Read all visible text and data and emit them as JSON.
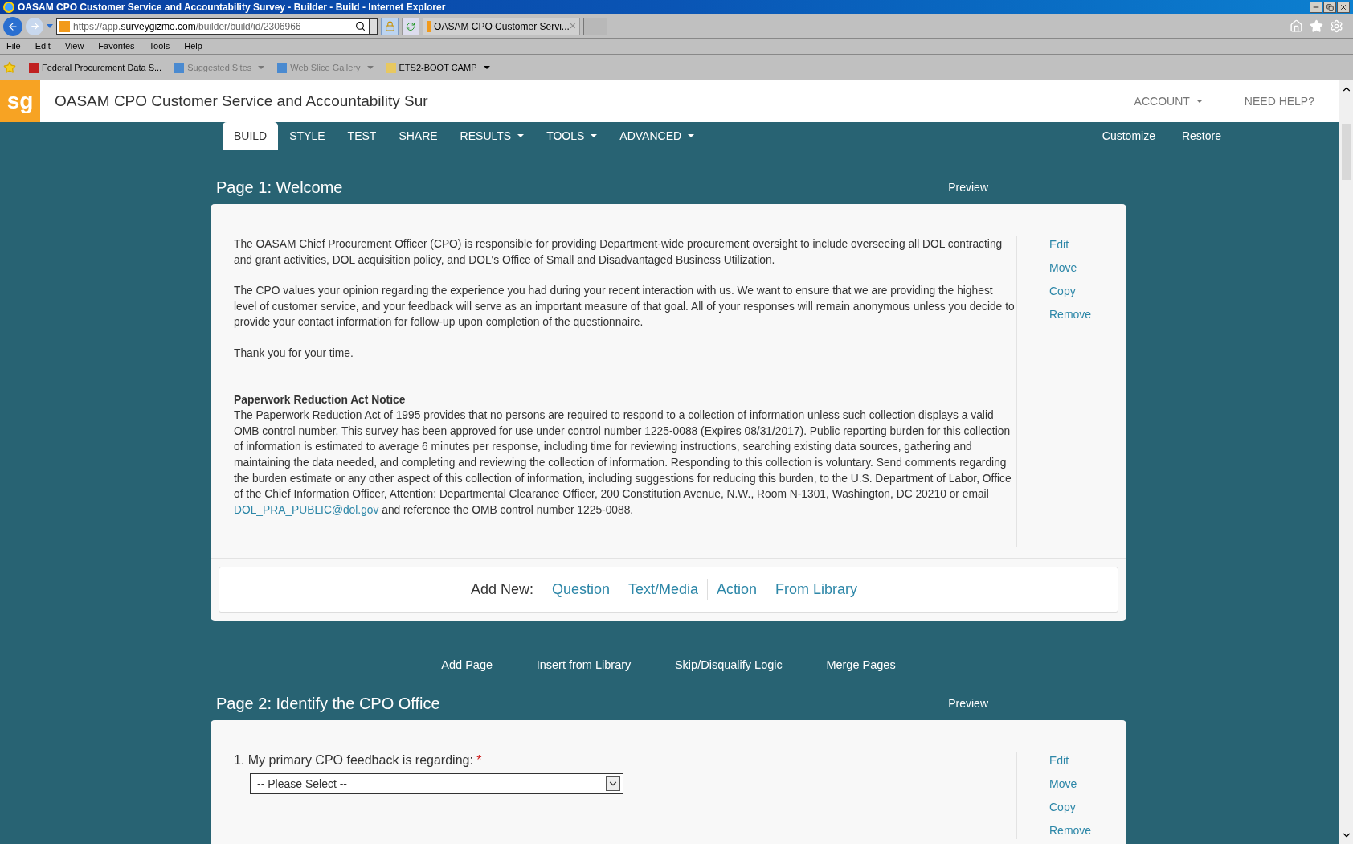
{
  "window": {
    "title": "OASAM CPO Customer Service and Accountability Survey - Builder - Build - Internet Explorer"
  },
  "address_bar": {
    "url_prefix": "https://app.",
    "url_domain": "surveygizmo.com",
    "url_path": "/builder/build/id/2306966"
  },
  "browser_tab": {
    "title": "OASAM CPO Customer Servi...",
    "close": "×"
  },
  "menu_bar": [
    "File",
    "Edit",
    "View",
    "Favorites",
    "Tools",
    "Help"
  ],
  "favorites_bar": [
    {
      "label": "Federal Procurement Data S...",
      "dropdown": false,
      "dimmed": false
    },
    {
      "label": "Suggested Sites",
      "dropdown": true,
      "dimmed": true
    },
    {
      "label": "Web Slice Gallery",
      "dropdown": true,
      "dimmed": true
    },
    {
      "label": "ETS2-BOOT CAMP",
      "dropdown": true,
      "dimmed": false
    }
  ],
  "app_header": {
    "logo": "sg",
    "survey_title": "OASAM CPO Customer Service and Accountability Sur",
    "account": "ACCOUNT",
    "help": "NEED HELP?"
  },
  "nav_tabs": [
    {
      "label": "BUILD",
      "selected": true,
      "dropdown": false
    },
    {
      "label": "STYLE",
      "selected": false,
      "dropdown": false
    },
    {
      "label": "TEST",
      "selected": false,
      "dropdown": false
    },
    {
      "label": "SHARE",
      "selected": false,
      "dropdown": false
    },
    {
      "label": "RESULTS",
      "selected": false,
      "dropdown": true
    },
    {
      "label": "TOOLS",
      "selected": false,
      "dropdown": true
    },
    {
      "label": "ADVANCED",
      "selected": false,
      "dropdown": true
    }
  ],
  "nav_links": [
    "Customize",
    "Restore"
  ],
  "page1": {
    "title": "Page 1: Welcome",
    "preview": "Preview",
    "paragraphs": [
      "The OASAM Chief Procurement Officer (CPO) is responsible for providing Department-wide procurement oversight to include overseeing all DOL contracting and grant activities, DOL acquisition policy, and DOL's Office of Small and Disadvantaged Business Utilization.",
      "The CPO values your opinion regarding the experience you had during your recent interaction with us. We want to ensure that we are providing the highest level of customer service, and your feedback will serve as an important measure of that goal. All of your responses will remain anonymous unless you decide to provide your contact information for follow-up upon completion of the questionnaire.",
      "Thank you for your time."
    ],
    "notice_heading": "Paperwork Reduction Act Notice",
    "notice_text": "The Paperwork Reduction Act of 1995 provides that no persons are required to respond to a collection of information unless such collection displays a valid OMB control number. This survey has been approved for use under control number 1225-0088 (Expires 08/31/2017). Public reporting burden for this collection of information is estimated to average 6 minutes per response, including time for reviewing instructions, searching existing data sources, gathering and maintaining the data needed, and completing and reviewing the collection of information. Responding to this collection is voluntary. Send comments regarding the burden estimate or any other aspect of this collection of information, including suggestions for reducing this burden, to the U.S. Department of Labor, Office of the Chief Information Officer, Attention: Departmental Clearance Officer, 200 Constitution Avenue, N.W., Room N-1301, Washington, DC 20210 or email",
    "notice_link": "DOL_PRA_PUBLIC@dol.gov",
    "notice_after": "and reference the OMB control number 1225-0088.",
    "actions": [
      "Edit",
      "Move",
      "Copy",
      "Remove"
    ],
    "add_new": {
      "label": "Add New:",
      "links": [
        "Question",
        "Text/Media",
        "Action",
        "From Library"
      ]
    }
  },
  "page_tools": [
    "Add Page",
    "Insert from Library",
    "Skip/Disqualify Logic",
    "Merge Pages"
  ],
  "page2": {
    "title": "Page 2: Identify the CPO Office",
    "preview": "Preview",
    "question": {
      "text": "1. My primary CPO feedback is regarding:",
      "required": true,
      "required_mark": "*",
      "select_value": "-- Please Select --"
    },
    "actions": [
      "Edit",
      "Move",
      "Copy",
      "Remove"
    ]
  }
}
